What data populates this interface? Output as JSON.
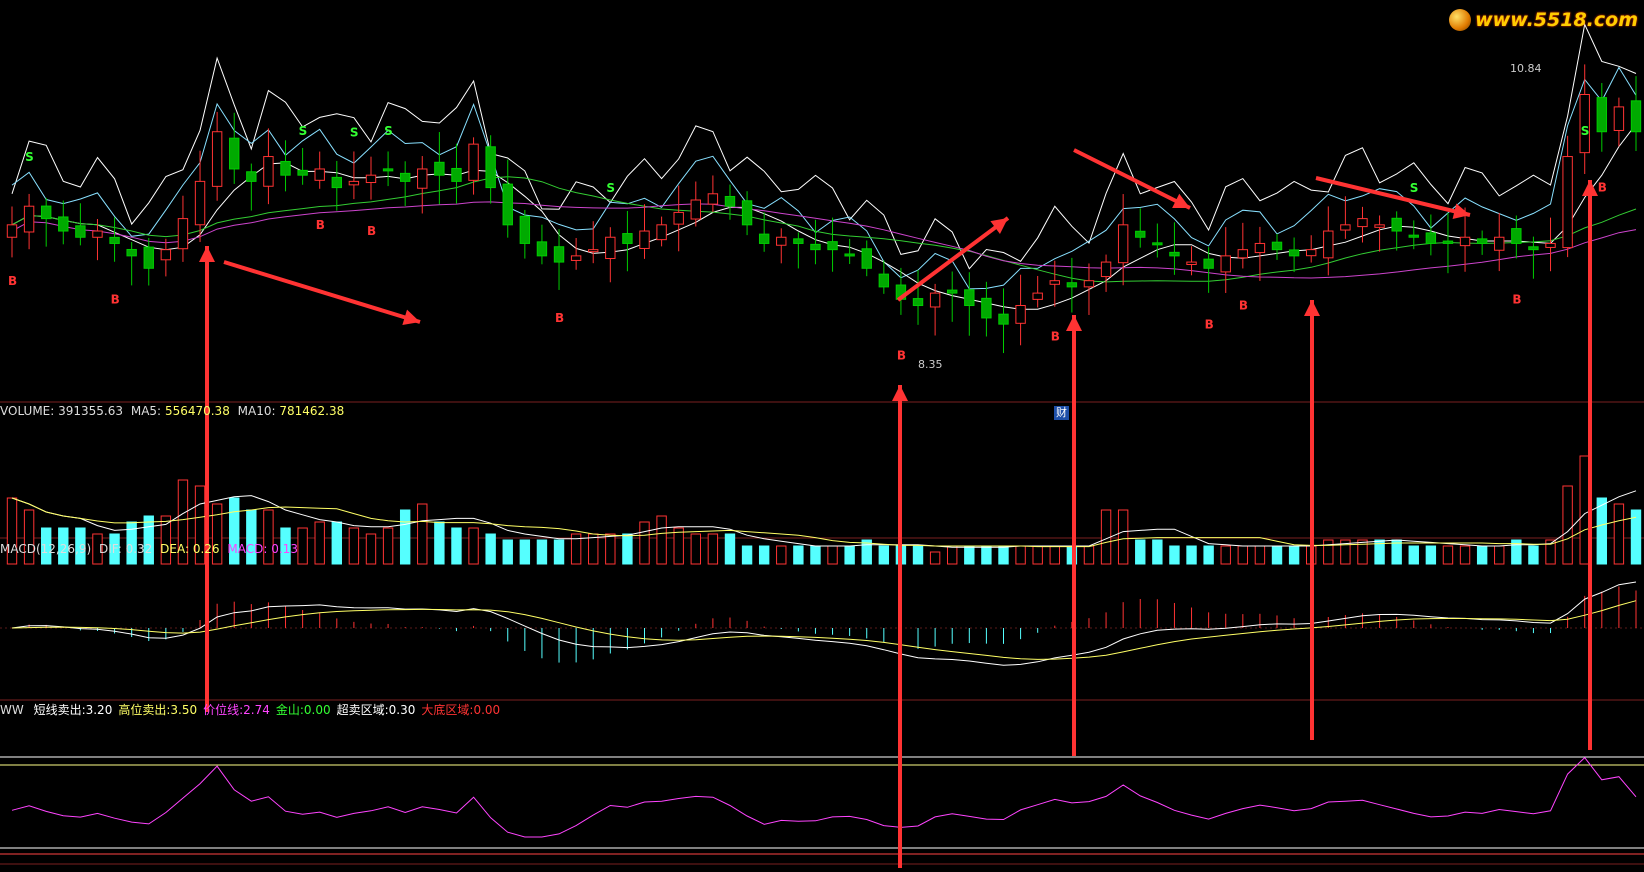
{
  "watermark": "www.5518.com",
  "volume_header": {
    "name": "VOLUME:",
    "value": "391355.63",
    "ma5_label": "MA5:",
    "ma5_value": "556470.38",
    "ma10_label": "MA10:",
    "ma10_value": "781462.38"
  },
  "macd_header": {
    "name": "MACD(12,26,9)",
    "dif_label": "DIF:",
    "dif_value": "0.32",
    "dea_label": "DEA:",
    "dea_value": "0.26",
    "macd_label": "MACD:",
    "macd_value": "0.13"
  },
  "indicator_header": {
    "name": "WW",
    "items": [
      {
        "label": "短线卖出:",
        "value": "3.20",
        "color": "#ffffff"
      },
      {
        "label": "高位卖出:",
        "value": "3.50",
        "color": "#ffff66"
      },
      {
        "label": "价位线:",
        "value": "2.74",
        "color": "#ff44ff"
      },
      {
        "label": "金山:",
        "value": "0.00",
        "color": "#33ff33"
      },
      {
        "label": "超卖区域:",
        "value": "0.30",
        "color": "#ffffff"
      },
      {
        "label": "大底区域:",
        "value": "0.00",
        "color": "#ff3333"
      }
    ]
  },
  "price_labels": {
    "high": "10.84",
    "low": "8.35"
  },
  "finance_marker": "财",
  "chart_data": {
    "type": "candlestick",
    "series_count": 96,
    "candles_note": "daily OHLC approx from price panel (price units, approx)",
    "close": [
      9.55,
      9.7,
      9.6,
      9.5,
      9.45,
      9.5,
      9.4,
      9.3,
      9.2,
      9.35,
      9.6,
      9.9,
      10.3,
      10.0,
      9.9,
      10.1,
      9.95,
      9.95,
      10.0,
      9.85,
      9.9,
      9.95,
      10.0,
      9.9,
      10.0,
      9.95,
      9.9,
      10.2,
      9.85,
      9.55,
      9.4,
      9.3,
      9.25,
      9.3,
      9.35,
      9.45,
      9.4,
      9.5,
      9.55,
      9.65,
      9.75,
      9.8,
      9.7,
      9.55,
      9.4,
      9.45,
      9.4,
      9.35,
      9.35,
      9.3,
      9.2,
      9.05,
      8.95,
      8.9,
      9.0,
      9.0,
      8.9,
      8.8,
      8.75,
      8.9,
      9.0,
      9.1,
      9.05,
      9.1,
      9.25,
      9.55,
      9.45,
      9.4,
      9.3,
      9.25,
      9.2,
      9.3,
      9.35,
      9.4,
      9.35,
      9.3,
      9.35,
      9.5,
      9.55,
      9.6,
      9.55,
      9.5,
      9.45,
      9.4,
      9.4,
      9.45,
      9.4,
      9.45,
      9.4,
      9.35,
      9.4,
      10.1,
      10.6,
      10.3,
      10.5,
      10.3
    ],
    "buy_signals_label": "B",
    "sell_signals_label": "S",
    "volume": {
      "series": [
        {
          "name": "VOLUME",
          "values": [
            1.1,
            0.9,
            0.6,
            0.6,
            0.6,
            0.5,
            0.5,
            0.7,
            0.8,
            0.8,
            1.4,
            1.3,
            1.0,
            1.1,
            0.9,
            0.9,
            0.6,
            0.6,
            0.7,
            0.7,
            0.6,
            0.5,
            0.6,
            0.9,
            1.0,
            0.7,
            0.6,
            0.6,
            0.5,
            0.4,
            0.4,
            0.4,
            0.4,
            0.5,
            0.5,
            0.5,
            0.5,
            0.7,
            0.8,
            0.6,
            0.5,
            0.5,
            0.5,
            0.3,
            0.3,
            0.3,
            0.3,
            0.3,
            0.3,
            0.3,
            0.4,
            0.3,
            0.3,
            0.3,
            0.2,
            0.3,
            0.3,
            0.3,
            0.3,
            0.3,
            0.3,
            0.3,
            0.3,
            0.3,
            0.9,
            0.9,
            0.4,
            0.4,
            0.3,
            0.3,
            0.3,
            0.3,
            0.3,
            0.3,
            0.3,
            0.3,
            0.3,
            0.4,
            0.4,
            0.4,
            0.4,
            0.4,
            0.3,
            0.3,
            0.3,
            0.3,
            0.3,
            0.3,
            0.4,
            0.3,
            0.4,
            1.3,
            1.8,
            1.1,
            1.0,
            0.9
          ]
        }
      ]
    }
  }
}
